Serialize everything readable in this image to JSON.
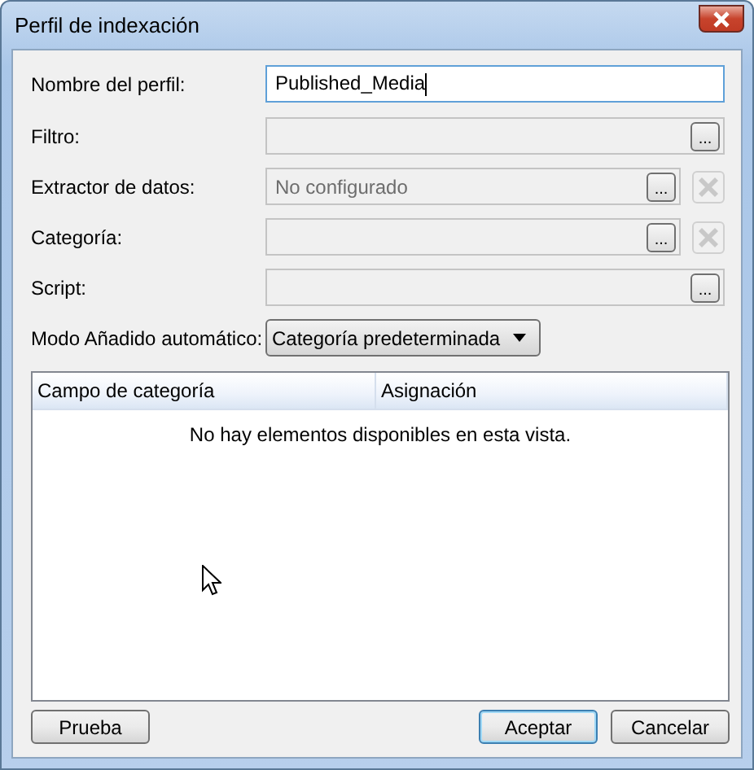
{
  "window": {
    "title": "Perfil de indexación"
  },
  "fields": [
    {
      "kind": "text",
      "label": "Nombre del perfil:",
      "value": "Published_Media",
      "disabled": false,
      "focused": true
    },
    {
      "kind": "browse",
      "label": "Filtro:",
      "browse": "...",
      "disabled": true
    },
    {
      "kind": "browse_clear",
      "label": "Extractor de datos:",
      "value": "No configurado",
      "browse": "...",
      "disabled": true
    },
    {
      "kind": "browse_clear",
      "label": "Categoría:",
      "browse": "...",
      "disabled": true
    },
    {
      "kind": "browse",
      "label": "Script:",
      "browse": "...",
      "disabled": true
    },
    {
      "kind": "dropdown",
      "label": "Modo Añadido automático:",
      "value": "Categoría predeterminada",
      "disabled": false
    }
  ],
  "table": {
    "columns": [
      "Campo de categoría",
      "Asignación"
    ],
    "empty_message": "No hay elementos disponibles en esta vista."
  },
  "left_buttons": [
    {
      "label": "Prueba",
      "default": false
    }
  ],
  "right_buttons": [
    {
      "label": "Aceptar",
      "default": true
    },
    {
      "label": "Cancelar",
      "default": false
    }
  ]
}
